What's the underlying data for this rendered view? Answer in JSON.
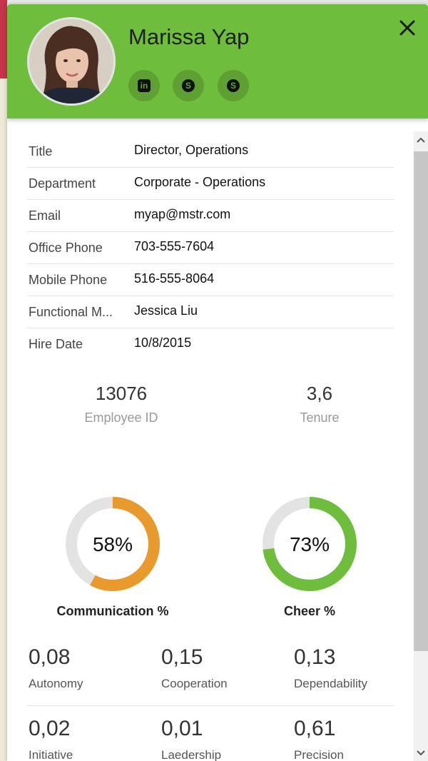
{
  "profile": {
    "name": "Marissa Yap",
    "social": [
      {
        "icon": "linkedin-icon",
        "glyph": "in"
      },
      {
        "icon": "skype-icon",
        "glyph": "S"
      },
      {
        "icon": "lync-icon",
        "glyph": "S"
      }
    ]
  },
  "details": [
    {
      "key": "Title",
      "value": "Director, Operations"
    },
    {
      "key": "Department",
      "value": "Corporate - Operations"
    },
    {
      "key": "Email",
      "value": "myap@mstr.com"
    },
    {
      "key": "Office Phone",
      "value": "703-555-7604"
    },
    {
      "key": "Mobile Phone",
      "value": "516-555-8064"
    },
    {
      "key": "Functional M...",
      "value": "Jessica Liu"
    },
    {
      "key": "Hire Date",
      "value": "10/8/2015"
    }
  ],
  "kpis": {
    "employee_id": {
      "value": "13076",
      "label": "Employee ID"
    },
    "tenure": {
      "value": "3,6",
      "label": "Tenure"
    }
  },
  "gauges": [
    {
      "label": "Communication %",
      "text": "58%",
      "value": 0.58,
      "color": "#e89a2c"
    },
    {
      "label": "Cheer %",
      "text": "73%",
      "value": 0.73,
      "color": "#6fbd3d"
    }
  ],
  "metrics": [
    {
      "value": "0,08",
      "label": "Autonomy"
    },
    {
      "value": "0,15",
      "label": "Cooperation"
    },
    {
      "value": "0,13",
      "label": "Dependability"
    },
    {
      "value": "0,02",
      "label": "Initiative"
    },
    {
      "value": "0,01",
      "label": "Laedership"
    },
    {
      "value": "0,61",
      "label": "Precision"
    }
  ],
  "colors": {
    "header": "#6fbd3d",
    "gauge_track": "#e3e3e3"
  }
}
